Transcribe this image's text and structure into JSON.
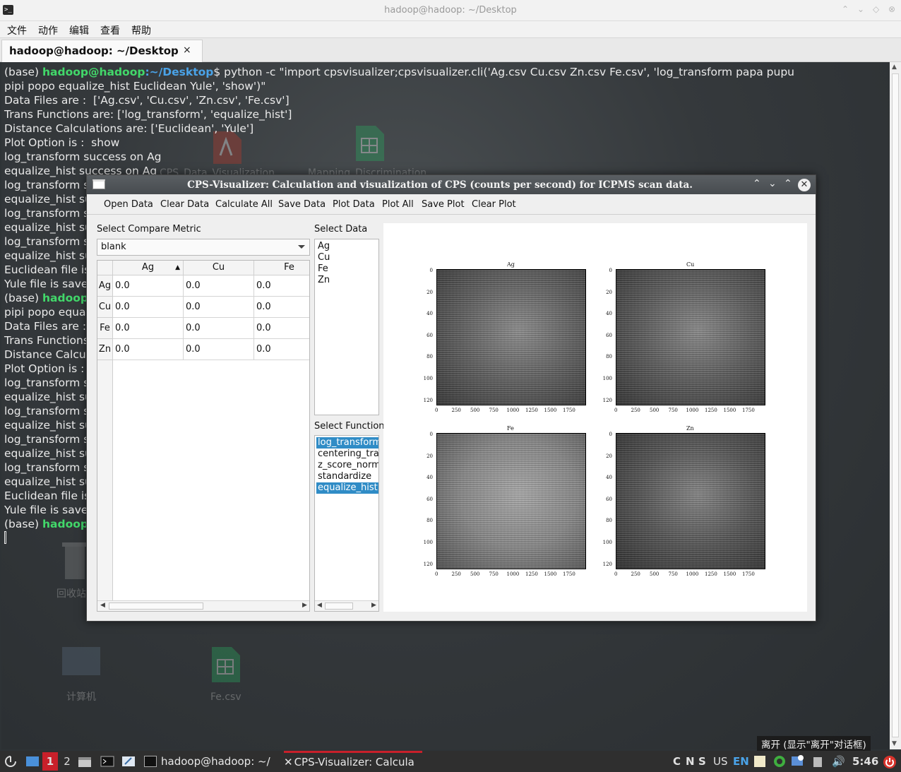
{
  "terminal": {
    "title": "hadoop@hadoop: ~/Desktop",
    "menu": [
      "文件",
      "动作",
      "编辑",
      "查看",
      "帮助"
    ],
    "tab_label": "hadoop@hadoop: ~/Desktop",
    "tab_close": "×",
    "prompt_prefix": "(base) ",
    "prompt_user": "hadoop@hadoop",
    "prompt_path": ":~/Desktop",
    "prompt_dollar": "$ ",
    "command_line1": "python -c \"import cpsvisualizer;cpsvisualizer.cli('Ag.csv Cu.csv Zn.csv Fe.csv', 'log_transform papa pupu",
    "command_line2": "pipi popo equalize_hist Euclidean Yule', 'show')\"",
    "output": [
      "Data Files are :  ['Ag.csv', 'Cu.csv', 'Zn.csv', 'Fe.csv']",
      "Trans Functions are: ['log_transform', 'equalize_hist']",
      "Distance Calculations are: ['Euclidean', 'Yule']",
      "Plot Option is :  show",
      "log_transform success on Ag",
      "equalize_hist success on Ag",
      "log_transform s",
      "equalize_hist su",
      "log_transform s",
      "equalize_hist su",
      "log_transform s",
      "equalize_hist su",
      "Euclidean file is",
      "Yule file is save"
    ],
    "second_prompt_user": "hadoop",
    "second_output": [
      "pipi popo equal",
      "Data Files are :",
      "Trans Functions",
      "Distance Calcul",
      "Plot Option is :",
      "log_transform s",
      "equalize_hist su",
      "log_transform s",
      "equalize_hist su",
      "log_transform s",
      "equalize_hist su",
      "log_transform s",
      "equalize_hist su",
      "Euclidean file is",
      "Yule file is save"
    ],
    "desktop_ghost_labels": [
      "CPS_Data_Visualization",
      "Mapping_Discrimination",
      "回收站",
      "计算机",
      "Fe.csv"
    ]
  },
  "cps_window": {
    "title": "CPS-Visualizer: Calculation and visualization of CPS (counts per second) for ICPMS scan data.",
    "menu": [
      "Open Data",
      "Clear Data",
      "Calculate All",
      "Save Data",
      "Plot Data",
      "Plot All",
      "Save Plot",
      "Clear Plot"
    ],
    "compare_metric_label": "Select Compare Metric",
    "compare_metric_value": "blank",
    "table": {
      "columns": [
        "Ag",
        "Cu",
        "Fe"
      ],
      "sort_indicator": "▲",
      "rows": [
        {
          "header": "Ag",
          "cells": [
            "0.0",
            "0.0",
            "0.0"
          ]
        },
        {
          "header": "Cu",
          "cells": [
            "0.0",
            "0.0",
            "0.0"
          ]
        },
        {
          "header": "Fe",
          "cells": [
            "0.0",
            "0.0",
            "0.0"
          ]
        },
        {
          "header": "Zn",
          "cells": [
            "0.0",
            "0.0",
            "0.0"
          ]
        }
      ]
    },
    "select_data_label": "Select Data",
    "data_items": [
      "Ag",
      "Cu",
      "Fe",
      "Zn"
    ],
    "select_function_label": "Select Function",
    "function_items": [
      {
        "label": "log_transform",
        "selected": true
      },
      {
        "label": "centering_tran",
        "selected": false
      },
      {
        "label": "z_score_norma",
        "selected": false
      },
      {
        "label": "standardize",
        "selected": false
      },
      {
        "label": "equalize_hist",
        "selected": true
      }
    ],
    "plots": [
      {
        "title": "Ag",
        "tone": "#5a5a5a"
      },
      {
        "title": "Cu",
        "tone": "#555555"
      },
      {
        "title": "Fe",
        "tone": "#8a8a8a"
      },
      {
        "title": "Zn",
        "tone": "#4e4e4e"
      }
    ],
    "y_ticks": [
      "0",
      "20",
      "40",
      "60",
      "80",
      "100",
      "120"
    ],
    "x_ticks": [
      "0",
      "250",
      "500",
      "750",
      "1000",
      "1250",
      "1500",
      "1750"
    ]
  },
  "taskbar": {
    "workspaces": [
      "1",
      "2"
    ],
    "tasks": [
      "hadoop@hadoop: ~/",
      "CPS-Visualizer: Calcula"
    ],
    "tray_text": [
      "C",
      "N",
      "S",
      "US",
      "EN"
    ],
    "clock": "5:46",
    "tooltip": "离开 (显示\"离开\"对话框)"
  },
  "colors": {
    "selection": "#308cc6",
    "prompt_user": "#42d86a",
    "prompt_path": "#4aa3e8",
    "taskbar_accent": "#c8202a"
  }
}
